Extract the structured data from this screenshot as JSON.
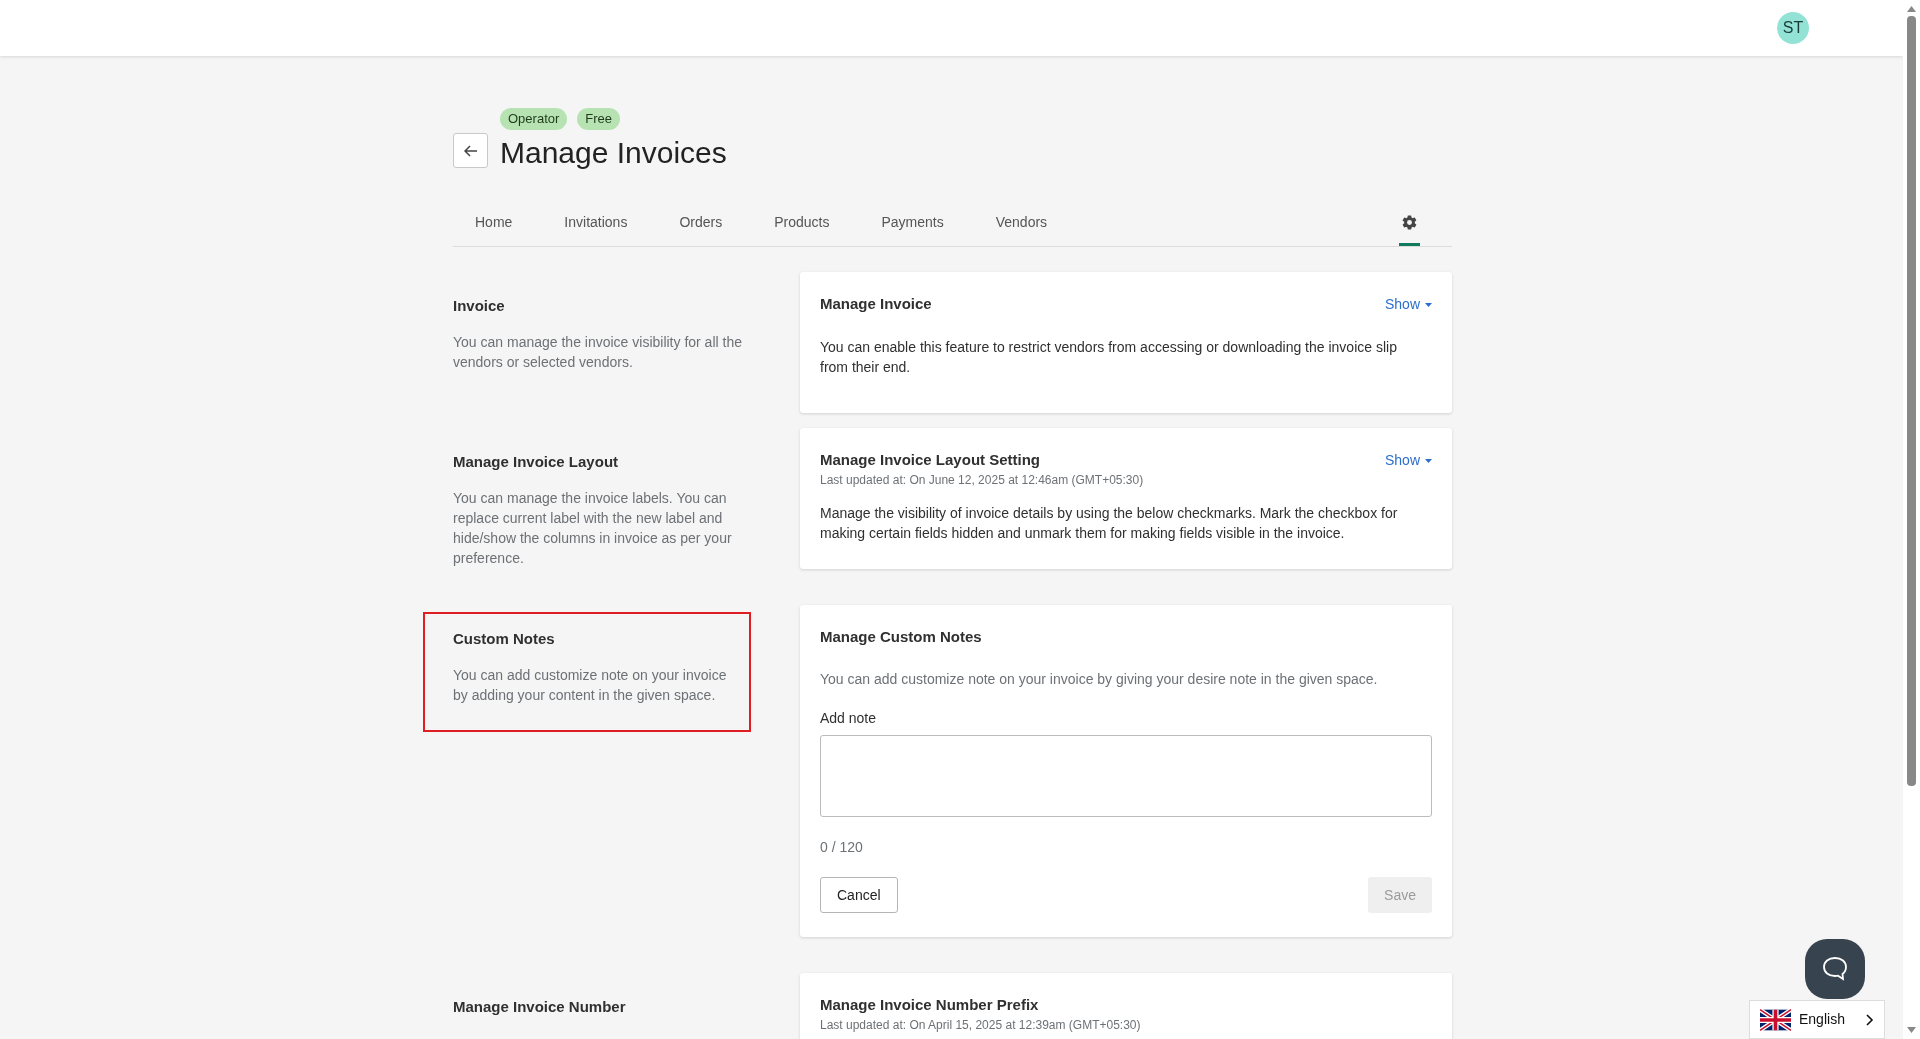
{
  "header": {
    "avatar_initials": "ST"
  },
  "page": {
    "badges": [
      "Operator",
      "Free"
    ],
    "title": "Manage Invoices"
  },
  "tabs": [
    {
      "label": "Home",
      "selected": false
    },
    {
      "label": "Invitations",
      "selected": false
    },
    {
      "label": "Orders",
      "selected": false
    },
    {
      "label": "Products",
      "selected": false
    },
    {
      "label": "Payments",
      "selected": false
    },
    {
      "label": "Vendors",
      "selected": false
    },
    {
      "kind": "settings",
      "selected": true
    }
  ],
  "sections": [
    {
      "kind": "toggle",
      "title": "Invoice",
      "description": "You can manage the invoice visibility for all the vendors or selected vendors.",
      "highlighted": false,
      "card_title": "Manage Invoice",
      "show_label": "Show",
      "card_text": "You can enable this feature to restrict vendors from accessing or downloading the invoice slip from their end."
    },
    {
      "kind": "toggle",
      "title": "Manage Invoice Layout",
      "description": "You can manage the invoice labels. You can replace current label with the new label and hide/show the columns in invoice as per your preference.",
      "highlighted": false,
      "card_title": "Manage Invoice Layout Setting",
      "updated": "Last updated at: On June 12, 2025 at 12:46am (GMT+05:30)",
      "show_label": "Show",
      "card_text": "Manage the visibility of invoice details by using the below checkmarks. Mark the checkbox for making certain fields hidden and unmark them for making fields visible in the invoice."
    },
    {
      "kind": "notes",
      "title": "Custom Notes",
      "description": "You can add customize note on your invoice by adding your content in the given space.",
      "highlighted": true,
      "card_title": "Manage Custom Notes",
      "card_text": "You can add customize note on your invoice by giving your desire note in the given space.",
      "field_label": "Add note",
      "counter": "0 / 120",
      "cancel": "Cancel",
      "save": "Save",
      "save_disabled": true
    },
    {
      "kind": "cut",
      "title": "Manage Invoice Number",
      "highlighted": false,
      "card_title": "Manage Invoice Number Prefix",
      "updated": "Last updated at: On April 15, 2025 at 12:39am (GMT+05:30)"
    }
  ],
  "language": {
    "label": "English"
  }
}
